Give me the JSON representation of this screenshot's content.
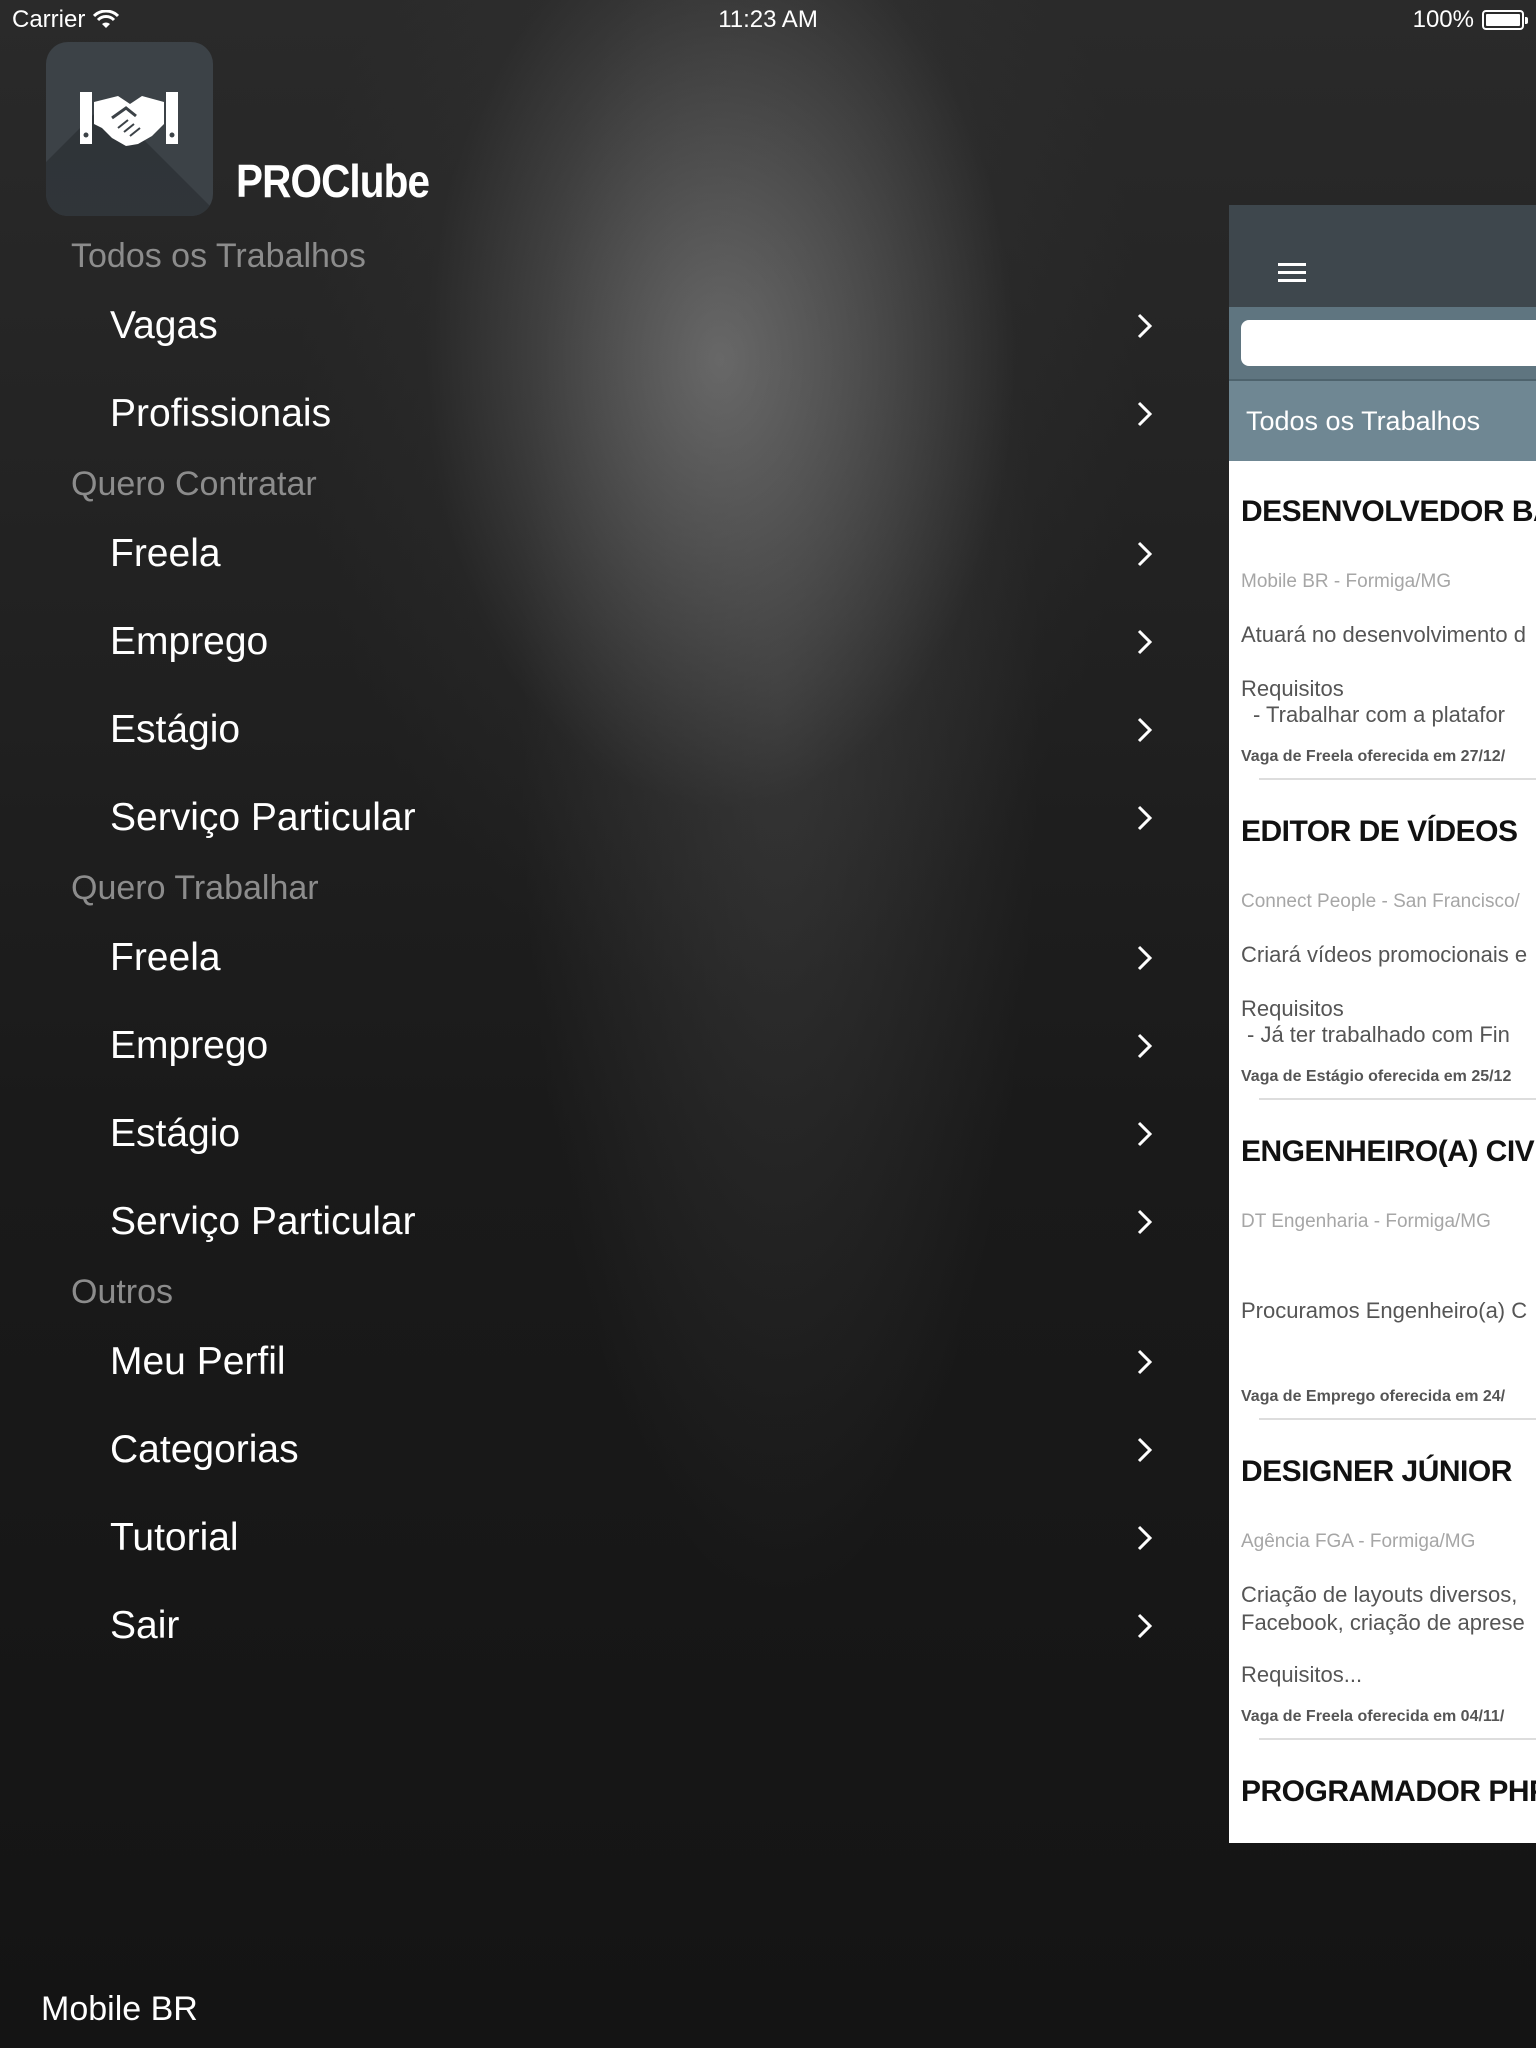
{
  "status_bar": {
    "carrier": "Carrier",
    "time": "11:23 AM",
    "battery": "100%",
    "battery_level": 1.0
  },
  "app": {
    "title": "PROClube",
    "icon": "handshake-icon"
  },
  "menu": {
    "sections": [
      {
        "header": "Todos os Trabalhos",
        "items": [
          {
            "label": "Vagas"
          },
          {
            "label": "Profissionais"
          }
        ]
      },
      {
        "header": "Quero Contratar",
        "items": [
          {
            "label": "Freela"
          },
          {
            "label": "Emprego"
          },
          {
            "label": "Estágio"
          },
          {
            "label": "Serviço Particular"
          }
        ]
      },
      {
        "header": "Quero Trabalhar",
        "items": [
          {
            "label": "Freela"
          },
          {
            "label": "Emprego"
          },
          {
            "label": "Estágio"
          },
          {
            "label": "Serviço Particular"
          }
        ]
      },
      {
        "header": "Outros",
        "items": [
          {
            "label": "Meu Perfil"
          },
          {
            "label": "Categorias"
          },
          {
            "label": "Tutorial"
          },
          {
            "label": "Sair"
          }
        ]
      }
    ]
  },
  "footer": {
    "text": "Mobile BR"
  },
  "preview": {
    "menu_icon": "hamburger-icon",
    "search_placeholder": "",
    "tab_label": "Todos os Trabalhos",
    "jobs": [
      {
        "title": "DESENVOLVEDOR BACK",
        "company": "Mobile BR - Formiga/MG",
        "desc": "Atuará no desenvolvimento d",
        "req_label": "Requisitos",
        "req_line": "- Trabalhar com a platafor",
        "offered": "Vaga de Freela oferecida em 27/12/"
      },
      {
        "title": "EDITOR DE VÍDEOS",
        "company": "Connect People - San Francisco/",
        "desc": "Criará vídeos promocionais e",
        "req_label": "Requisitos",
        "req_line": "- Já ter trabalhado com Fin",
        "offered": "Vaga de Estágio oferecida em 25/12"
      },
      {
        "title": "ENGENHEIRO(A) CIVIL",
        "company": "DT Engenharia - Formiga/MG",
        "desc": "Procuramos Engenheiro(a) C",
        "req_label": "",
        "req_line": "",
        "offered": "Vaga de Emprego oferecida em 24/"
      },
      {
        "title": "DESIGNER JÚNIOR",
        "company": "Agência FGA - Formiga/MG",
        "desc": "Criação de layouts diversos,",
        "desc2": "Facebook, criação de aprese",
        "req_label": "Requisitos...",
        "req_line": "",
        "offered": "Vaga de Freela oferecida em 04/11/"
      },
      {
        "title": "PROGRAMADOR PHP"
      }
    ]
  }
}
